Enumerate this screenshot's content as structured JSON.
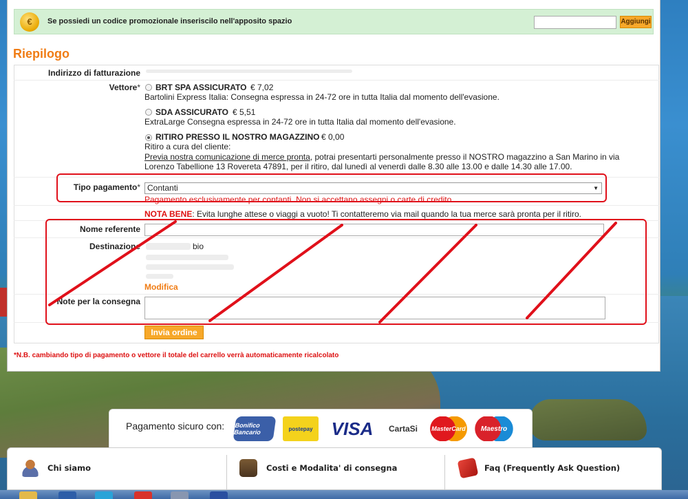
{
  "promo": {
    "text": "Se possiedi un codice promozionale inseriscilo nell'apposito spazio",
    "input_value": "",
    "button_label": "Aggiungi"
  },
  "title": "Riepilogo",
  "billing": {
    "label": "Indirizzo di fatturazione"
  },
  "carrier": {
    "label": "Vettore",
    "required_mark": "*",
    "options": [
      {
        "name": "BRT SPA ASSICURATO",
        "price": "€ 7,02",
        "desc": "Bartolini Express Italia: Consegna espressa in 24-72 ore in tutta Italia dal momento dell'evasione.",
        "selected": false
      },
      {
        "name": "SDA ASSICURATO",
        "price": "€ 5,51",
        "desc": "ExtraLarge Consegna espressa in 24-72 ore in tutta Italia dal momento dell'evasione.",
        "selected": false
      },
      {
        "name": "RITIRO PRESSO IL NOSTRO MAGAZZINO",
        "price": "€ 0,00",
        "desc": "Ritiro a cura del cliente:",
        "selected": true
      }
    ],
    "pickup_link": "Previa nostra comunicazione di merce pronta",
    "pickup_text_1": ", potrai presentarti personalmente presso il NOSTRO magazzino a San Marino in via",
    "pickup_text_2": "Lorenzo Tabellione 13 Rovereta 47891, per il ritiro, dal lunedì al venerdì dalle 8.30 alle 13.00 e dalle 14.30 alle 17.00."
  },
  "payment": {
    "label": "Tipo pagamento",
    "required_mark": "*",
    "selected": "Contanti",
    "warning": "Pagamento esclusivamente per contanti. Non si accettano assegni o carte di credito.",
    "nota_label": "NOTA BENE",
    "nota_text": ": Evita lunghe attese o viaggi a vuoto! Ti contatteremo via mail quando la tua merce sarà pronta per il ritiro."
  },
  "referente": {
    "label": "Nome referente",
    "value": ""
  },
  "destinazione": {
    "label": "Destinazione",
    "visible_fragment": "bio",
    "edit_link": "Modifica"
  },
  "note": {
    "label": "Note per la consegna",
    "value": ""
  },
  "submit_label": "Invia ordine",
  "footnote": "*N.B. cambiando tipo di pagamento o vettore il totale del carrello verrà automaticamente ricalcolato",
  "secure_payment": {
    "label": "Pagamento sicuro con:",
    "logos": [
      "Bonifico Bancario",
      "postepay",
      "VISA",
      "CartaSi",
      "MasterCard",
      "Maestro"
    ]
  },
  "footer_links": [
    {
      "label": "Chi siamo",
      "icon": "people-icon"
    },
    {
      "label": "Costi e Modalita' di consegna",
      "icon": "truck-icon"
    },
    {
      "label": "Faq (Frequently Ask Question)",
      "icon": "faq-icon"
    }
  ],
  "colors": {
    "accent": "#f07c14",
    "annotation": "#e0101a",
    "alert": "#dd1111",
    "promo_bg": "#d4f0d4"
  }
}
